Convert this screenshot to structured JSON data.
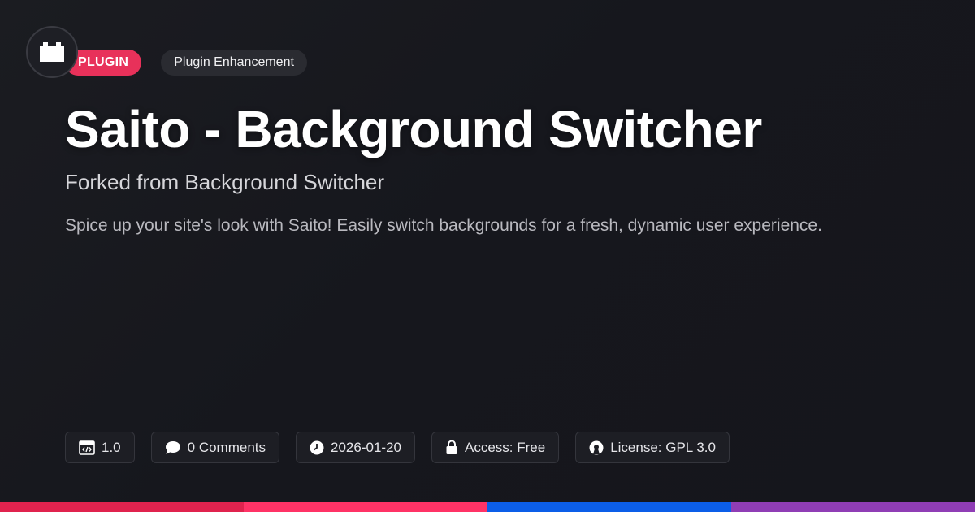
{
  "badges": {
    "type_label": "PLUGIN",
    "category_label": "Plugin Enhancement"
  },
  "header": {
    "title": "Saito - Background Switcher",
    "subtitle": "Forked from Background Switcher",
    "description": "Spice up your site's look with Saito! Easily switch backgrounds for a fresh, dynamic user experience."
  },
  "meta": {
    "version": "1.0",
    "comments": "0 Comments",
    "date": "2026-01-20",
    "access": "Access: Free",
    "license": "License: GPL 3.0"
  },
  "icons": {
    "logo": "plugin-block-icon",
    "version": "code-window-icon",
    "comments": "speech-bubble-icon",
    "date": "clock-icon",
    "access": "lock-icon",
    "license": "open-source-icon"
  },
  "colors": {
    "background": "#16171d",
    "plugin_badge": "#e8315a",
    "category_badge": "#2a2b31",
    "chip_background": "#1d1e24",
    "chip_border": "#34353c",
    "bar_segments": [
      "#e0234e",
      "#ff3366",
      "#0c5ee8",
      "#8f3db5"
    ]
  }
}
